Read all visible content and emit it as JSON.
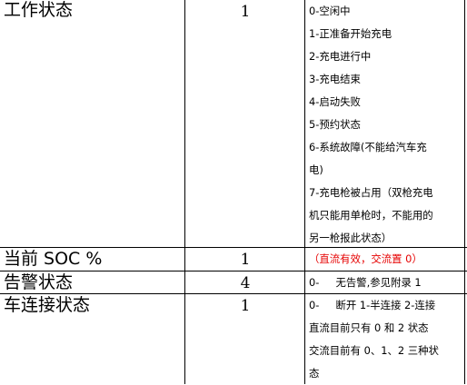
{
  "rows": [
    {
      "name": "工作状态",
      "length": "1",
      "desc_lines": [
        "0-空闲中",
        "1-正准备开始充电",
        "2-充电进行中",
        "3-充电结束",
        "4-启动失败",
        "5-预约状态",
        "6-系统故障(不能给汽车充",
        "电)",
        "7-充电枪被占用（双枪充电",
        "机只能用单枪时，不能用的",
        "另一枪报此状态）"
      ]
    },
    {
      "name": "当前 SOC %",
      "length": "1",
      "desc_lines": [
        "（直流有效，交流置 0）"
      ],
      "desc_color": "#e60000"
    },
    {
      "name": "告警状态",
      "length": "4",
      "desc_lines": [
        "0-     无告警,参见附录 1"
      ]
    },
    {
      "name": "车连接状态",
      "length": "1",
      "desc_lines": [
        "0-     断开 1-半连接 2-连接",
        "直流目前只有 0 和 2 状态",
        "交流目前有 0、1、2 三种状",
        "态"
      ]
    }
  ]
}
